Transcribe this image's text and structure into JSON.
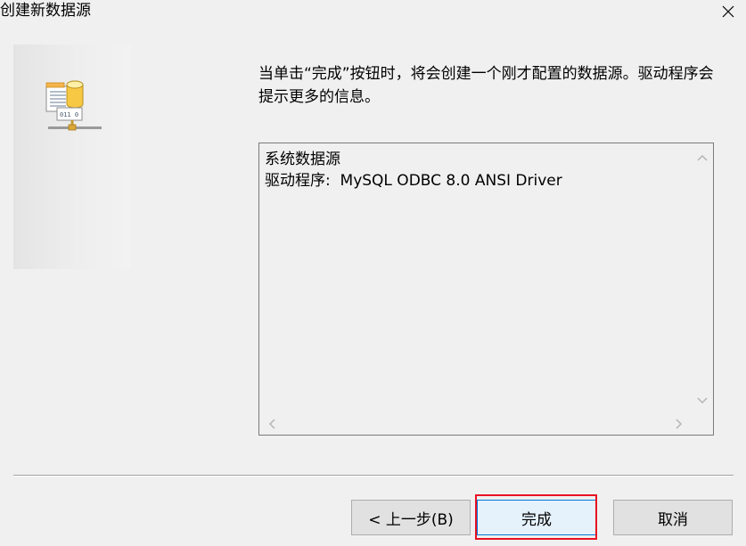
{
  "window": {
    "title": "创建新数据源"
  },
  "description": "当单击“完成”按钮时，将会创建一个刚才配置的数据源。驱动程序会提示更多的信息。",
  "info_box": {
    "lines": [
      "系统数据源",
      "驱动程序:  MySQL ODBC 8.0 ANSI Driver"
    ]
  },
  "side_icon": {
    "name": "database-icon",
    "binary_label": "011 0"
  },
  "buttons": {
    "back": "< 上一步(B)",
    "finish": "完成",
    "cancel": "取消"
  },
  "colors": {
    "focus_highlight": "#e81123",
    "default_button_border": "#0078d7",
    "background": "#f0f0f0"
  }
}
